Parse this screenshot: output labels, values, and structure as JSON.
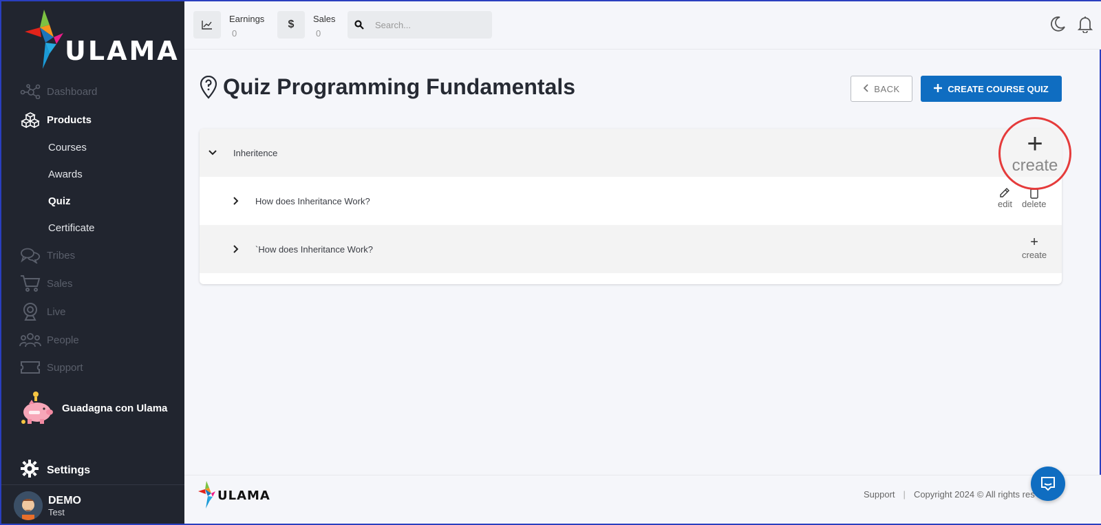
{
  "brand": {
    "name": "ULAMA"
  },
  "sidebar": {
    "items": [
      {
        "label": "Dashboard",
        "icon": "dashboard-icon"
      },
      {
        "label": "Products",
        "icon": "cubes-icon"
      },
      {
        "label": "Tribes",
        "icon": "chat-bubbles-icon"
      },
      {
        "label": "Sales",
        "icon": "cart-icon"
      },
      {
        "label": "Live",
        "icon": "webcam-icon"
      },
      {
        "label": "People",
        "icon": "people-icon"
      },
      {
        "label": "Support",
        "icon": "ticket-icon"
      }
    ],
    "sub_items": [
      {
        "label": "Courses"
      },
      {
        "label": "Awards"
      },
      {
        "label": "Quiz"
      },
      {
        "label": "Certificate"
      }
    ],
    "promo_label": "Guadagna con Ulama",
    "settings_label": "Settings",
    "user": {
      "name": "DEMO",
      "subtitle": "Test"
    }
  },
  "topbar": {
    "earnings": {
      "label": "Earnings",
      "value": "0"
    },
    "sales": {
      "label": "Sales",
      "value": "0",
      "icon_glyph": "$"
    },
    "search_placeholder": "Search..."
  },
  "main": {
    "title": "Quiz Programming Fundamentals",
    "back_label": "BACK",
    "create_quiz_label": "CREATE COURSE QUIZ",
    "rows": [
      {
        "label": "Inheritence",
        "expanded": true
      },
      {
        "label": "How does Inheritance Work?",
        "actions": [
          "edit",
          "delete"
        ]
      },
      {
        "label": "`How does Inheritance Work?",
        "actions": [
          "create"
        ]
      }
    ],
    "action_labels": {
      "edit": "edit",
      "delete": "delete",
      "create": "create"
    },
    "callout_label": "create"
  },
  "footer": {
    "support": "Support",
    "separator": "|",
    "copyright": "Copyright 2024 © All rights res"
  },
  "colors": {
    "sidebar_bg": "#21252f",
    "primary": "#0f6dc1",
    "callout": "#e53b3b"
  }
}
